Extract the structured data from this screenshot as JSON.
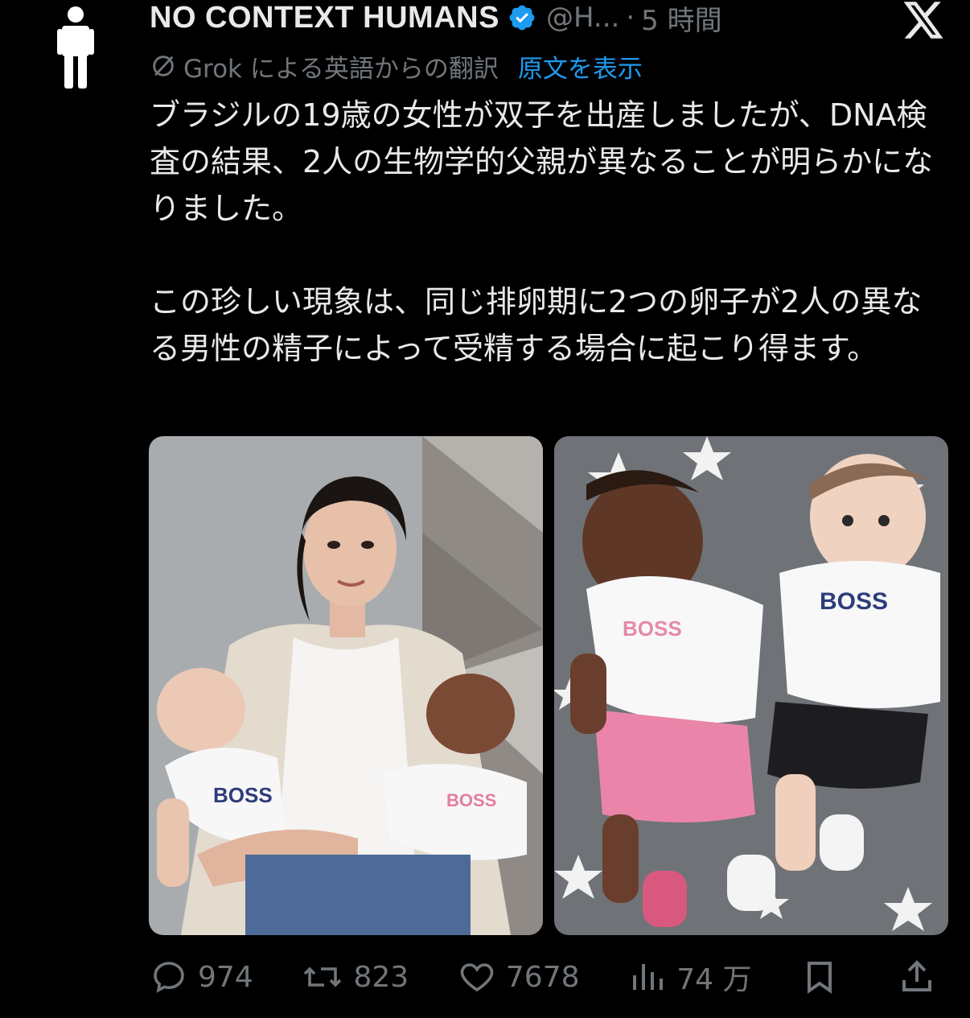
{
  "tweet": {
    "author_name": "NO CONTEXT HUMANS",
    "handle": "@H...",
    "separator": "·",
    "time": "5 時間",
    "translation_label": "Grok による英語からの翻訳",
    "show_original": "原文を表示",
    "paragraphs": [
      "ブラジルの19歳の女性が双子を出産しましたが、DNA検査の結果、2人の生物学的父親が異なることが明らかになりました。",
      "この珍しい現象は、同じ排卵期に2つの卵子が2人の異なる男性の精子によって受精する場合に起こり得ます。"
    ]
  },
  "media": {
    "left_shirt_text_1": "BOSS",
    "left_shirt_text_2": "BOSS",
    "right_shirt_text_1": "BOSS",
    "right_shirt_text_2": "BOSS"
  },
  "actions": {
    "replies": "974",
    "reposts": "823",
    "likes": "7678",
    "views": "74 万"
  },
  "colors": {
    "background": "#000000",
    "text": "#e7e9ea",
    "muted": "#71767b",
    "link": "#1d9bf0",
    "verified": "#1d9bf0"
  },
  "icons": [
    "person-avatar-icon",
    "verified-badge-icon",
    "x-logo-icon",
    "translate-icon",
    "reply-icon",
    "repost-icon",
    "like-icon",
    "views-icon",
    "bookmark-icon",
    "share-icon"
  ]
}
